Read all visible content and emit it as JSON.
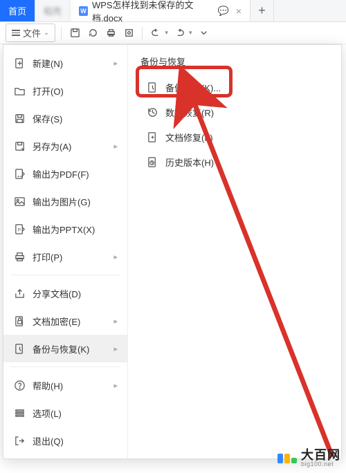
{
  "tabs": {
    "home": "首页",
    "blur": "稻壳",
    "doc_icon": "W",
    "doc_title": "WPS怎样找到未保存的文档.docx",
    "plus": "+"
  },
  "toolbar": {
    "file_label": "文件"
  },
  "menu_left": [
    {
      "label": "新建(N)",
      "icon": "new",
      "arrow": true
    },
    {
      "label": "打开(O)",
      "icon": "open"
    },
    {
      "label": "保存(S)",
      "icon": "save"
    },
    {
      "label": "另存为(A)",
      "icon": "saveas",
      "arrow": true
    },
    {
      "label": "输出为PDF(F)",
      "icon": "pdf"
    },
    {
      "label": "输出为图片(G)",
      "icon": "image"
    },
    {
      "label": "输出为PPTX(X)",
      "icon": "ppt"
    },
    {
      "label": "打印(P)",
      "icon": "print",
      "arrow": true
    },
    {
      "divider": true
    },
    {
      "label": "分享文档(D)",
      "icon": "share"
    },
    {
      "label": "文档加密(E)",
      "icon": "lock",
      "arrow": true
    },
    {
      "label": "备份与恢复(K)",
      "icon": "backup",
      "arrow": true,
      "active": true
    },
    {
      "divider": true
    },
    {
      "label": "帮助(H)",
      "icon": "help",
      "arrow": true
    },
    {
      "label": "选项(L)",
      "icon": "options"
    },
    {
      "label": "退出(Q)",
      "icon": "exit"
    }
  ],
  "submenu": {
    "title": "备份与恢复",
    "items": [
      {
        "label": "备份中心(K)...",
        "icon": "backup-center"
      },
      {
        "label": "数据恢复(R)",
        "icon": "recover"
      },
      {
        "label": "文档修复(F)",
        "icon": "repair"
      },
      {
        "label": "历史版本(H)",
        "icon": "history"
      }
    ]
  },
  "watermark": {
    "text": "大百网",
    "sub": "big100.net"
  }
}
